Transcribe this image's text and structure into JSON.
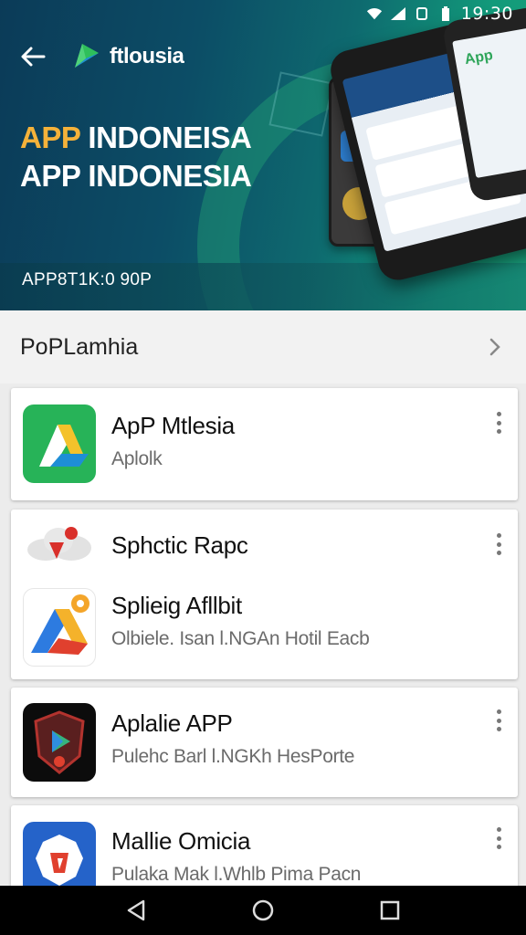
{
  "status_bar": {
    "time": "19:30",
    "icons": [
      "wifi-icon",
      "signal-icon",
      "nfc-icon",
      "battery-icon"
    ]
  },
  "header": {
    "brand_name": "ftlousia",
    "back_icon": "arrow-left-icon"
  },
  "banner": {
    "title_accent": "APP",
    "title_line1_rest": " INDONEISA",
    "title_line2": "APP INDONESIA",
    "subtitle": "APP8T1K:0 90P"
  },
  "section": {
    "title": "PoPLamhia",
    "chevron_icon": "chevron-right-icon"
  },
  "apps": [
    {
      "title": "ApP Mtlesia",
      "subtitle": "Aplolk"
    },
    {
      "title": "Sphctic Rapc",
      "subtitle": ""
    },
    {
      "title": "Splieig Afllbit",
      "subtitle": "Olbiele. Isan l.NGAn Hotil Eacb"
    },
    {
      "title": "Aplalie APP",
      "subtitle": "Pulehc Barl l.NGKh HesPorte"
    },
    {
      "title": "Mallie Omicia",
      "subtitle": "Pulaka Mak l.Whlb Pima Pacn"
    }
  ],
  "colors": {
    "banner_start": "#0b3b58",
    "banner_end": "#1aa07b",
    "accent": "#f5b23a",
    "card_bg": "#ffffff",
    "page_bg": "#ececec"
  },
  "nav_bar": {
    "icons": [
      "back-triangle-icon",
      "home-circle-icon",
      "recents-square-icon"
    ]
  }
}
